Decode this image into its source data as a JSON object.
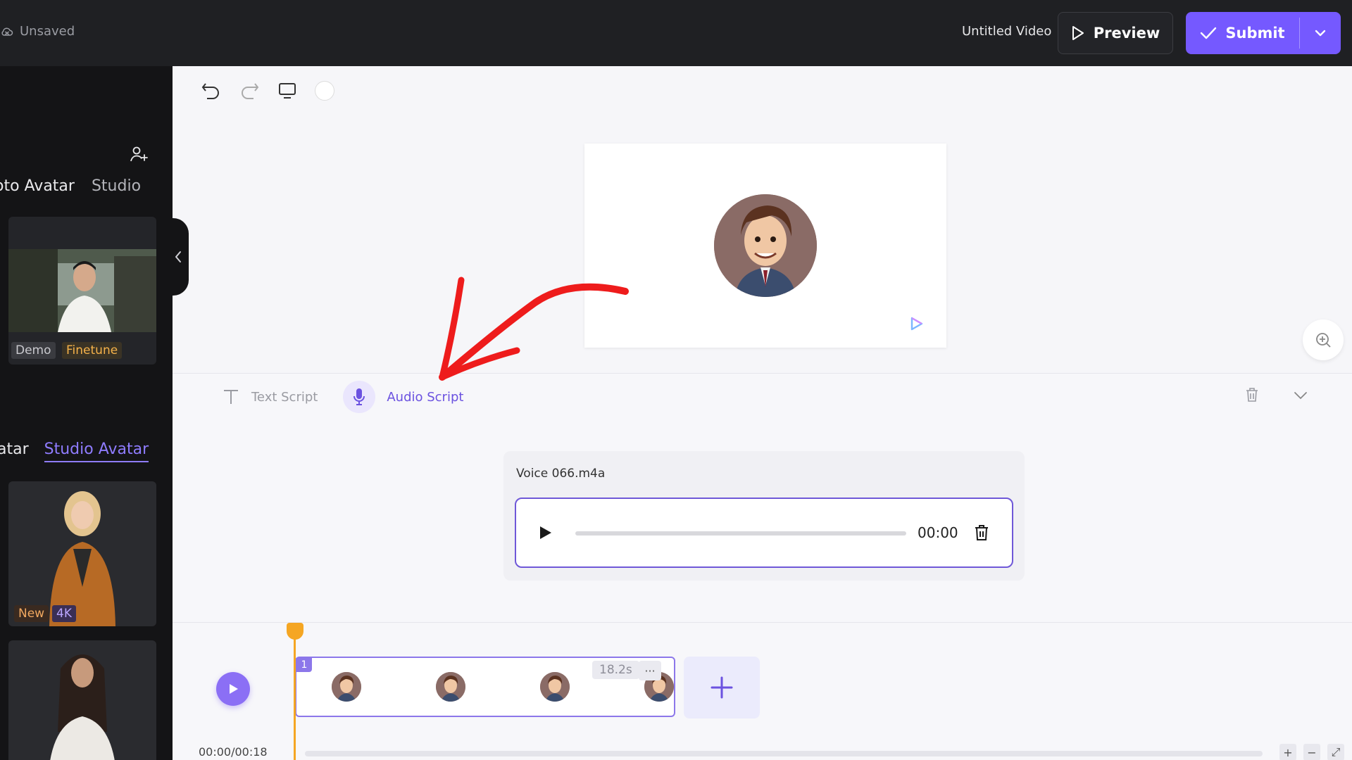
{
  "topbar": {
    "unsaved_label": "Unsaved",
    "video_title": "Untitled Video",
    "preview_label": "Preview",
    "submit_label": "Submit"
  },
  "sidebar": {
    "top_tabs": [
      "oto Avatar",
      "Studio"
    ],
    "card1_badges": [
      "Demo",
      "Finetune"
    ],
    "mid_tabs": [
      "atar",
      "Studio Avatar"
    ],
    "card2_badges": [
      "New",
      "4K"
    ]
  },
  "script": {
    "text_tab": "Text Script",
    "audio_tab": "Audio Script",
    "file_name": "Voice 066.m4a",
    "time": "00:00"
  },
  "timeline": {
    "clip_number": "1",
    "duration": "18.2s",
    "more": "···",
    "timecode": "00:00/00:18"
  },
  "colors": {
    "accent": "#7559ff",
    "playhead": "#f5a623",
    "annotation_arrow": "#ee1c1c"
  }
}
